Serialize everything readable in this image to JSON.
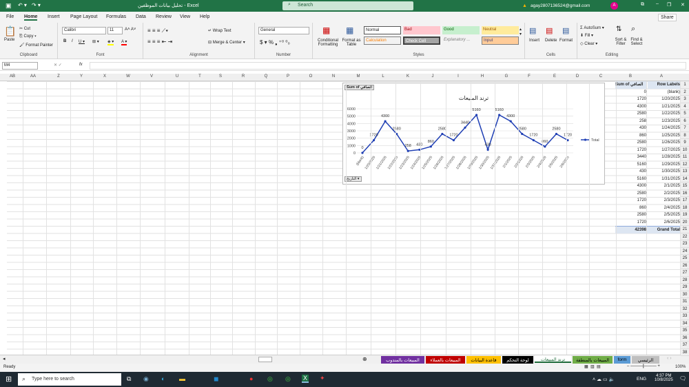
{
  "titlebar": {
    "title": "تحليل بيانات الموظفين - Excel",
    "search": "Search",
    "account": "agay2807136524@gmail.com",
    "avatar": "A"
  },
  "menu": [
    "File",
    "Home",
    "Insert",
    "Page Layout",
    "Formulas",
    "Data",
    "Review",
    "View",
    "Help"
  ],
  "share": "Share",
  "ribbon": {
    "clipboard": {
      "paste": "Paste",
      "cut": "Cut",
      "copy": "Copy",
      "format_painter": "Format Painter",
      "label": "Clipboard"
    },
    "font": {
      "name": "Calibri",
      "size": "11",
      "label": "Font"
    },
    "alignment": {
      "wrap": "Wrap Text",
      "merge": "Merge & Center",
      "label": "Alignment"
    },
    "number": {
      "format": "General",
      "label": "Number"
    },
    "styles": {
      "cond": "Conditional Formatting",
      "table": "Format as Table",
      "normal": "Normal",
      "bad": "Bad",
      "good": "Good",
      "neutral": "Neutral",
      "calculation": "Calculation",
      "check": "Check Cell",
      "explanatory": "Explanatory ...",
      "input": "Input",
      "label": "Styles"
    },
    "cells": {
      "insert": "Insert",
      "delete": "Delete",
      "format": "Format",
      "label": "Cells"
    },
    "editing": {
      "autosum": "AutoSum",
      "fill": "Fill",
      "clear": "Clear",
      "sort": "Sort & Filter",
      "find": "Find & Select",
      "label": "Editing"
    }
  },
  "formula_bar": {
    "name_box": "M4",
    "fx": "fx",
    "value": ""
  },
  "columns": [
    "AB",
    "AA",
    "Z",
    "Y",
    "X",
    "W",
    "V",
    "U",
    "T",
    "S",
    "R",
    "Q",
    "P",
    "O",
    "N",
    "M",
    "L",
    "K",
    "J",
    "I",
    "H",
    "G",
    "F",
    "E",
    "D",
    "C",
    "B",
    "A"
  ],
  "pivot": {
    "header_values": "Sum of الصافي",
    "header_labels": "Row Labels",
    "rows": [
      [
        "(blank)",
        "0"
      ],
      [
        "1/20/2025",
        "1720"
      ],
      [
        "1/21/2025",
        "4300"
      ],
      [
        "1/22/2025",
        "2580"
      ],
      [
        "1/23/2025",
        "258"
      ],
      [
        "1/24/2025",
        "430"
      ],
      [
        "1/25/2025",
        "860"
      ],
      [
        "1/26/2025",
        "2580"
      ],
      [
        "1/27/2025",
        "1720"
      ],
      [
        "1/28/2025",
        "3440"
      ],
      [
        "1/29/2025",
        "5160"
      ],
      [
        "1/30/2025",
        "430"
      ],
      [
        "1/31/2025",
        "5160"
      ],
      [
        "2/1/2025",
        "4300"
      ],
      [
        "2/2/2025",
        "2580"
      ],
      [
        "2/3/2025",
        "1720"
      ],
      [
        "2/4/2025",
        "860"
      ],
      [
        "2/5/2025",
        "2580"
      ],
      [
        "2/6/2025",
        "1720"
      ]
    ],
    "total_label": "Grand Total",
    "total_value": "42398"
  },
  "chart_data": {
    "type": "line",
    "title": "ترند المبيعات",
    "field_button": "Sum of الصافي",
    "axis_button": "التاريخ",
    "categories": [
      "(blank)",
      "1/20/2025",
      "1/21/2025",
      "1/22/2025",
      "1/23/2025",
      "1/24/2025",
      "1/25/2025",
      "1/26/2025",
      "1/27/2025",
      "1/28/2025",
      "1/29/2025",
      "1/30/2025",
      "1/31/2025",
      "2/1/2025",
      "2/2/2025",
      "2/3/2025",
      "2/4/2025",
      "2/5/2025",
      "2/6/2025"
    ],
    "series": [
      {
        "name": "Total",
        "values": [
          0,
          1720,
          4300,
          2580,
          258,
          430,
          860,
          2580,
          1720,
          3440,
          5160,
          430,
          5160,
          4300,
          2580,
          1720,
          860,
          2580,
          1720
        ]
      }
    ],
    "ylim": [
      0,
      6000
    ],
    "yticks": [
      0,
      1000,
      2000,
      3000,
      4000,
      5000,
      6000
    ],
    "legend": "right",
    "color": "#1f3fb4"
  },
  "tabs": [
    {
      "label": "المبيعات بالمندوب",
      "bg": "#7030a0",
      "fg": "#fff"
    },
    {
      "label": "المبيعات بالعملاء",
      "bg": "#c00000",
      "fg": "#fff"
    },
    {
      "label": "قاعدة البيانات",
      "bg": "#ffc000",
      "fg": "#000"
    },
    {
      "label": "لوحة التحكم",
      "bg": "#000000",
      "fg": "#fff"
    },
    {
      "label": "ترند المبيعات",
      "bg": "#ffffff",
      "fg": "#1e6b3a"
    },
    {
      "label": "المبيعات بالمنطقة",
      "bg": "#70ad47",
      "fg": "#000"
    },
    {
      "label": "form",
      "bg": "#5b9bd5",
      "fg": "#000"
    },
    {
      "label": "الرئيسي",
      "bg": "#bfbfbf",
      "fg": "#000"
    }
  ],
  "status": {
    "ready": "Ready",
    "zoom": "100%"
  },
  "taskbar": {
    "search": "Type here to search",
    "lang": "ENG",
    "time": "4:37 PM",
    "date": "10/8/2025",
    "notif": "4"
  }
}
